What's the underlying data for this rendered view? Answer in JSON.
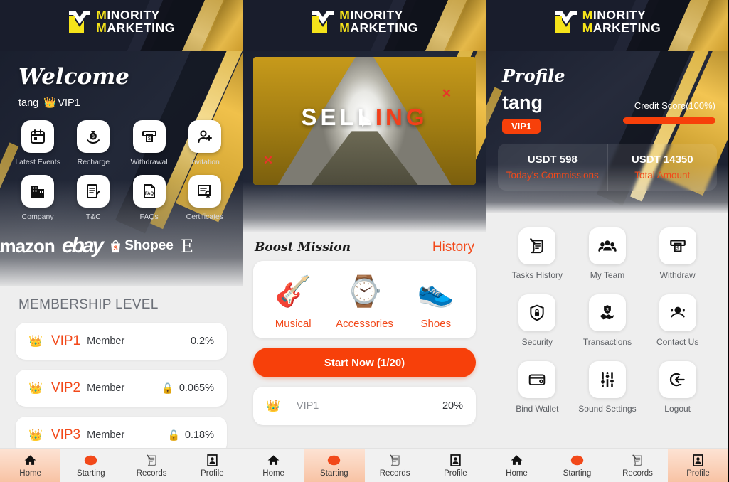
{
  "brand": {
    "line1_first": "M",
    "line1_rest": "INORITY",
    "line2_first": "M",
    "line2_rest": "ARKETING",
    "logo_yellow": "#f5e31a",
    "accent_orange": "#f7400a",
    "dark_navy": "#1a1f2e"
  },
  "home": {
    "welcome_title": "Welcome",
    "username": "tang",
    "vip_tag": "VIP1",
    "crown_icon": "crown-icon",
    "shortcuts": [
      {
        "label": "Latest Events",
        "icon": "calendar-icon"
      },
      {
        "label": "Recharge",
        "icon": "money-bag-hand-icon"
      },
      {
        "label": "Withdrawal",
        "icon": "atm-cash-icon"
      },
      {
        "label": "Invitation",
        "icon": "add-user-icon"
      },
      {
        "label": "Company",
        "icon": "building-icon"
      },
      {
        "label": "T&C",
        "icon": "document-pen-icon"
      },
      {
        "label": "FAQs",
        "icon": "faq-document-icon"
      },
      {
        "label": "Certificates",
        "icon": "certificate-icon"
      }
    ],
    "partners": [
      {
        "name": "amazon",
        "style": "amazon"
      },
      {
        "name": "ebay",
        "style": "ebay"
      },
      {
        "name": "Shopee",
        "style": "shopee"
      },
      {
        "name": "E",
        "style": "e"
      }
    ],
    "membership_title": "MEMBERSHIP LEVEL",
    "levels": [
      {
        "level": "VIP1",
        "member": "Member",
        "rate": "0.2%",
        "locked": false
      },
      {
        "level": "VIP2",
        "member": "Member",
        "rate": "0.065%",
        "locked": true
      },
      {
        "level": "VIP3",
        "member": "Member",
        "rate": "0.18%",
        "locked": true
      }
    ]
  },
  "starting": {
    "banner": {
      "text_white": "SELL",
      "text_red": "ING"
    },
    "boost_title": "Boost Mission",
    "history_label": "History",
    "categories": [
      {
        "label": "Musical",
        "icon": "guitar-icon",
        "glyph": "🎸"
      },
      {
        "label": "Accessories",
        "icon": "watch-icon",
        "glyph": "⌚"
      },
      {
        "label": "Shoes",
        "icon": "sneaker-icon",
        "glyph": "👟"
      }
    ],
    "start_button": "Start Now  (1/20)",
    "progress_row": {
      "level": "VIP1",
      "percent": "20%",
      "icon": "crown-icon"
    }
  },
  "profile": {
    "title": "Profile",
    "username": "tang",
    "vip_badge": "VIP1",
    "credit_label": "Credit Score(100%)",
    "credit_percent": 100,
    "stats": [
      {
        "value": "USDT 598",
        "label": "Today's Commissions"
      },
      {
        "value": "USDT 14350",
        "label": "Total Amount"
      }
    ],
    "menu": [
      {
        "label": "Tasks History",
        "icon": "scroll-pen-icon"
      },
      {
        "label": "My Team",
        "icon": "people-group-icon"
      },
      {
        "label": "Withdraw",
        "icon": "atm-cash-icon"
      },
      {
        "label": "Security",
        "icon": "shield-lock-icon"
      },
      {
        "label": "Transactions",
        "icon": "handshake-shield-icon"
      },
      {
        "label": "Contact Us",
        "icon": "headset-support-icon"
      },
      {
        "label": "Bind Wallet",
        "icon": "wallet-icon"
      },
      {
        "label": "Sound Settings",
        "icon": "sliders-icon"
      },
      {
        "label": "Logout",
        "icon": "logout-arrow-icon"
      }
    ]
  },
  "nav": {
    "items": [
      {
        "label": "Home",
        "icon": "home-icon"
      },
      {
        "label": "Starting",
        "icon": "start-circle-icon"
      },
      {
        "label": "Records",
        "icon": "scroll-pen-icon"
      },
      {
        "label": "Profile",
        "icon": "id-card-icon"
      }
    ],
    "active_home": "Home",
    "active_starting": "Starting",
    "active_profile": "Profile"
  }
}
